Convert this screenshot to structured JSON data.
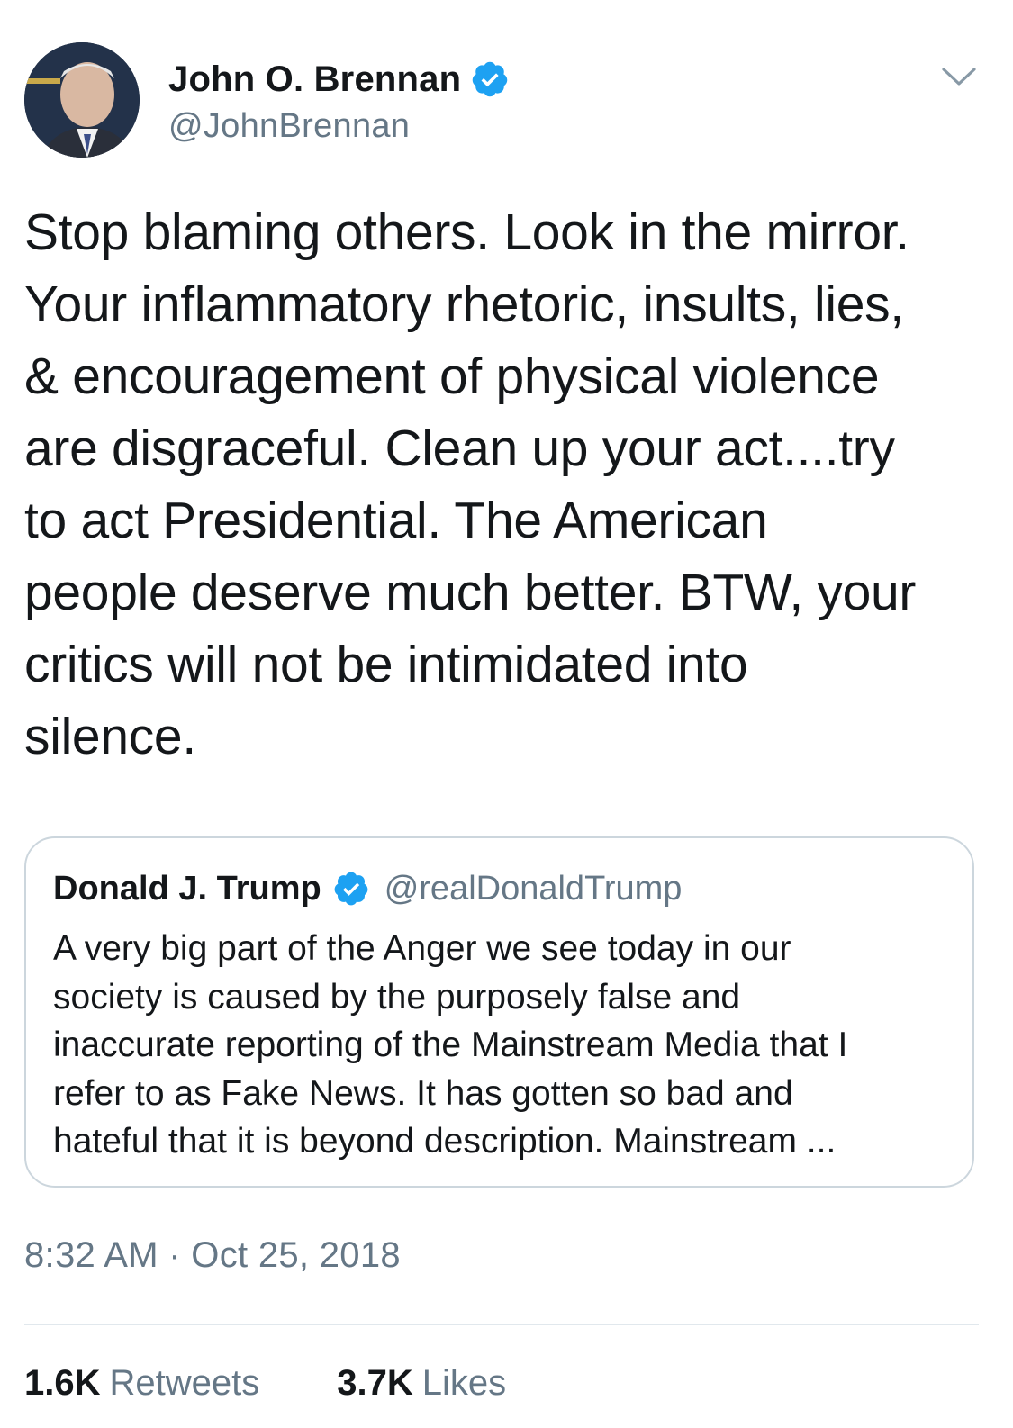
{
  "colors": {
    "text_primary": "#14171a",
    "text_secondary": "#657786",
    "verified_blue": "#1da1f2",
    "border": "#ccd6dd"
  },
  "tweet": {
    "author": {
      "display_name": "John O. Brennan",
      "handle": "@JohnBrennan",
      "verified": true,
      "avatar_icon": "profile-photo"
    },
    "menu_icon": "chevron-down-icon",
    "text": "Stop blaming others. Look in the mirror.\nYour inflammatory rhetoric, insults, lies,\n& encouragement of physical violence\nare disgraceful. Clean up your act....try\nto act Presidential. The American\npeople deserve much better. BTW, your\ncritics will not be intimidated into\nsilence.",
    "quoted": {
      "display_name": "Donald J. Trump",
      "handle": "@realDonaldTrump",
      "verified": true,
      "text": "A very big part of the Anger we see today in our\nsociety is caused by the purposely false and\ninaccurate reporting of the Mainstream Media that I\nrefer to as Fake News. It has gotten so bad and\nhateful that it is beyond description. Mainstream ..."
    },
    "timestamp": "8:32 AM · Oct 25, 2018",
    "stats": {
      "retweets_count": "1.6K",
      "retweets_label": "Retweets",
      "likes_count": "3.7K",
      "likes_label": "Likes"
    }
  }
}
